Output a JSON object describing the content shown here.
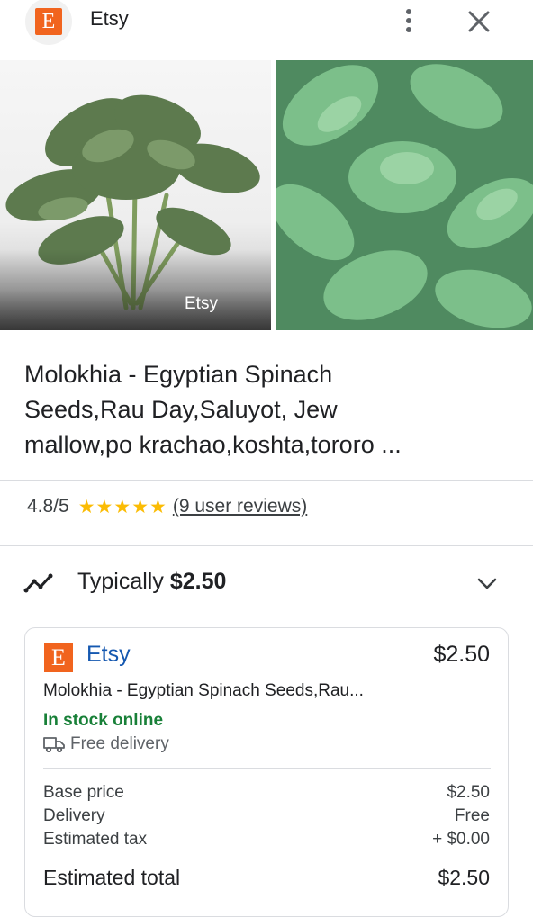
{
  "header": {
    "logo_letter": "E",
    "title": "Etsy"
  },
  "gallery": {
    "overlay_label": "Etsy"
  },
  "product": {
    "title_line1": "Molokhia - Egyptian Spinach",
    "title_line2": "Seeds,Rau Day,Saluyot, Jew",
    "title_line3": "mallow,po krachao,koshta,tororo ..."
  },
  "rating": {
    "value": "4.8/5",
    "stars": "★★★★★",
    "reviews": "(9 user reviews)"
  },
  "price_summary": {
    "prefix": "Typically ",
    "price": "$2.50"
  },
  "offer": {
    "logo_letter": "E",
    "seller": "Etsy",
    "price": "$2.50",
    "description": "Molokhia - Egyptian Spinach Seeds,Rau...",
    "stock": "In stock online",
    "delivery": "Free delivery",
    "breakdown": [
      {
        "label": "Base price",
        "value": "$2.50"
      },
      {
        "label": "Delivery",
        "value": "Free"
      },
      {
        "label": "Estimated tax",
        "value": "+ $0.00"
      }
    ],
    "total_label": "Estimated total",
    "total_value": "$2.50"
  },
  "colors": {
    "etsy_orange": "#f1641e",
    "star_yellow": "#fbbc04",
    "stock_green": "#188038",
    "link_blue": "#1558b0"
  }
}
